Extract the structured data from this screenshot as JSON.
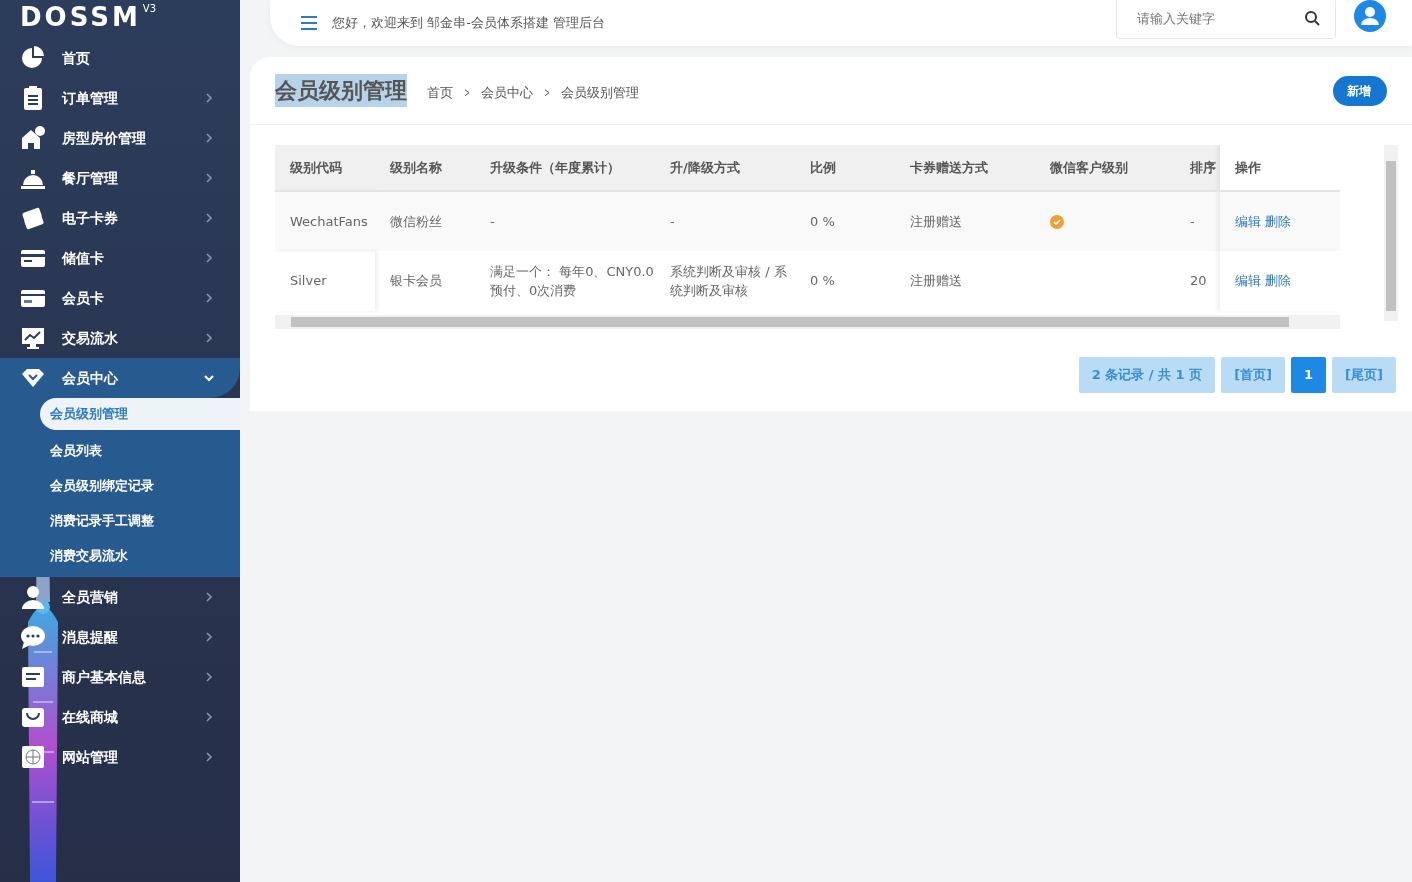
{
  "logo": {
    "text": "DOSSM",
    "version": "V3"
  },
  "sidebar": {
    "items": [
      {
        "label": "首页",
        "expandable": false,
        "expanded": false
      },
      {
        "label": "订单管理",
        "expandable": true,
        "expanded": false
      },
      {
        "label": "房型房价管理",
        "expandable": true,
        "expanded": false
      },
      {
        "label": "餐厅管理",
        "expandable": true,
        "expanded": false
      },
      {
        "label": "电子卡券",
        "expandable": true,
        "expanded": false
      },
      {
        "label": "储值卡",
        "expandable": true,
        "expanded": false
      },
      {
        "label": "会员卡",
        "expandable": true,
        "expanded": false
      },
      {
        "label": "交易流水",
        "expandable": true,
        "expanded": false
      },
      {
        "label": "会员中心",
        "expandable": true,
        "expanded": true,
        "children": [
          {
            "label": "会员级别管理",
            "selected": true
          },
          {
            "label": "会员列表",
            "selected": false
          },
          {
            "label": "会员级别绑定记录",
            "selected": false
          },
          {
            "label": "消费记录手工调整",
            "selected": false
          },
          {
            "label": "消费交易流水",
            "selected": false
          }
        ]
      },
      {
        "label": "全员营销",
        "expandable": true,
        "expanded": false
      },
      {
        "label": "消息提醒",
        "expandable": true,
        "expanded": false
      },
      {
        "label": "商户基本信息",
        "expandable": true,
        "expanded": false
      },
      {
        "label": "在线商城",
        "expandable": true,
        "expanded": false
      },
      {
        "label": "网站管理",
        "expandable": true,
        "expanded": false
      }
    ]
  },
  "header": {
    "welcome": "您好，欢迎来到 邹金串-会员体系搭建 管理后台",
    "search": {
      "placeholder": "请输入关键字"
    }
  },
  "page": {
    "title": "会员级别管理",
    "title_highlighted": true,
    "breadcrumb": [
      "首页",
      "会员中心",
      "会员级别管理"
    ],
    "add_button": "新增"
  },
  "table": {
    "columns": [
      "级别代码",
      "级别名称",
      "升级条件（年度累计）",
      "升/降级方式",
      "比例",
      "卡券赠送方式",
      "微信客户级别",
      "排序",
      "操作"
    ],
    "rows": [
      {
        "code": "WechatFans",
        "name": "微信粉丝",
        "condition": "-",
        "method": "-",
        "ratio": "0 %",
        "gift": "注册赠送",
        "wechat_level": true,
        "order": "-",
        "actions": [
          "编辑",
          "删除"
        ]
      },
      {
        "code": "Silver",
        "name": "银卡会员",
        "condition": "满足一个： 每年0、CNY0.0预付、0次消费",
        "method": "系统判断及审核 / 系统判断及审核",
        "ratio": "0 %",
        "gift": "注册赠送",
        "wechat_level": false,
        "order": "20",
        "actions": [
          "编辑",
          "删除"
        ]
      }
    ]
  },
  "pagination": {
    "summary": "2 条记录 / 共 1 页",
    "first": "[首页]",
    "pages": [
      {
        "label": "1",
        "selected": true
      }
    ],
    "last": "[尾页]"
  }
}
